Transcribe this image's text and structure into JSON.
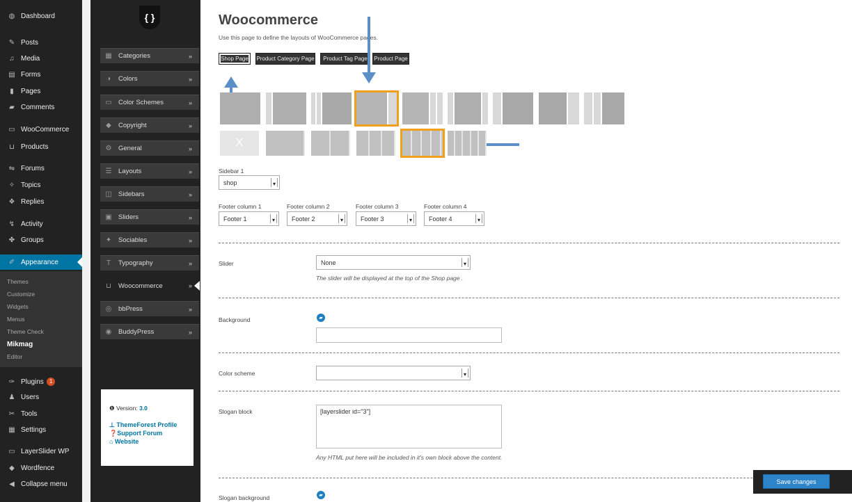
{
  "wp_menu": {
    "items": [
      {
        "label": "Dashboard",
        "icon": "dashboard-icon",
        "glyph": "◍"
      },
      {
        "label": "Posts",
        "icon": "pin-icon",
        "glyph": "✎"
      },
      {
        "label": "Media",
        "icon": "media-icon",
        "glyph": "♫"
      },
      {
        "label": "Forms",
        "icon": "forms-icon",
        "glyph": "▤"
      },
      {
        "label": "Pages",
        "icon": "pages-icon",
        "glyph": "▮"
      },
      {
        "label": "Comments",
        "icon": "comments-icon",
        "glyph": "▰"
      },
      {
        "label": "WooCommerce",
        "icon": "woocommerce-icon",
        "glyph": "▭"
      },
      {
        "label": "Products",
        "icon": "cart-icon",
        "glyph": "⊔"
      },
      {
        "label": "Forums",
        "icon": "forums-icon",
        "glyph": "⇋"
      },
      {
        "label": "Topics",
        "icon": "topics-icon",
        "glyph": "✧"
      },
      {
        "label": "Replies",
        "icon": "replies-icon",
        "glyph": "❖"
      },
      {
        "label": "Activity",
        "icon": "activity-icon",
        "glyph": "↯"
      },
      {
        "label": "Groups",
        "icon": "groups-icon",
        "glyph": "✤"
      },
      {
        "label": "Appearance",
        "icon": "paintbrush-icon",
        "glyph": "✐"
      },
      {
        "label": "Plugins",
        "icon": "plugin-icon",
        "glyph": "✑",
        "badge": "1"
      },
      {
        "label": "Users",
        "icon": "user-icon",
        "glyph": "♟"
      },
      {
        "label": "Tools",
        "icon": "wrench-icon",
        "glyph": "✂"
      },
      {
        "label": "Settings",
        "icon": "settings-icon",
        "glyph": "▦"
      },
      {
        "label": "LayerSlider WP",
        "icon": "layerslider-icon",
        "glyph": "▭"
      },
      {
        "label": "Wordfence",
        "icon": "wordfence-icon",
        "glyph": "◆"
      },
      {
        "label": "Collapse menu",
        "icon": "collapse-icon",
        "glyph": "◀"
      }
    ],
    "submenu": [
      "Themes",
      "Customize",
      "Widgets",
      "Menus",
      "Theme Check",
      "Mikmag",
      "Editor"
    ],
    "active_color": "#0074a2"
  },
  "theme_panel": {
    "logo": "{ }",
    "items": [
      {
        "label": "Categories",
        "icon": "categories-icon",
        "glyph": "▦"
      },
      {
        "label": "Colors",
        "icon": "colors-icon",
        "glyph": "◑"
      },
      {
        "label": "Color Schemes",
        "icon": "color-schemes-icon",
        "glyph": "▭"
      },
      {
        "label": "Copyright",
        "icon": "copyright-icon",
        "glyph": "◆"
      },
      {
        "label": "General",
        "icon": "gears-icon",
        "glyph": "⚙"
      },
      {
        "label": "Layouts",
        "icon": "layouts-icon",
        "glyph": "☰"
      },
      {
        "label": "Sidebars",
        "icon": "sidebars-icon",
        "glyph": "◫"
      },
      {
        "label": "Sliders",
        "icon": "sliders-icon",
        "glyph": "▣"
      },
      {
        "label": "Sociables",
        "icon": "twitter-icon",
        "glyph": "✦"
      },
      {
        "label": "Typography",
        "icon": "typography-icon",
        "glyph": "T"
      },
      {
        "label": "Woocommerce",
        "icon": "cart-icon",
        "glyph": "⊔"
      },
      {
        "label": "bbPress",
        "icon": "bbpress-icon",
        "glyph": "◎"
      },
      {
        "label": "BuddyPress",
        "icon": "buddypress-icon",
        "glyph": "◉"
      }
    ],
    "chevron": "»",
    "version_label": "Version:",
    "version": "3.0",
    "links": [
      "ThemeForest Profile",
      "Support Forum",
      "Website"
    ]
  },
  "main": {
    "title": "Woocommerce",
    "description": "Use this page to define the layouts of WooCommerce pages.",
    "tabs": [
      "Shop Page",
      "Product Category Page",
      "Product Tag Page",
      "Product Page"
    ],
    "active_tab": "Shop Page",
    "none_symbol": "X",
    "sidebar_label": "Sidebar 1",
    "sidebar_value": "shop",
    "footer_columns": [
      {
        "label": "Footer column 1",
        "value": "Footer 1"
      },
      {
        "label": "Footer column 2",
        "value": "Footer 2"
      },
      {
        "label": "Footer column 3",
        "value": "Footer 3"
      },
      {
        "label": "Footer column 4",
        "value": "Footer 4"
      }
    ],
    "slider_label": "Slider",
    "slider_value": "None",
    "slider_help": "The slider will be displayed at the top of the Shop page .",
    "background_label": "Background",
    "color_scheme_label": "Color scheme",
    "slogan_label": "Slogan block",
    "slogan_value": "[layerslider id=\"3\"]",
    "slogan_help": "Any HTML put here will be included in it's own block above the content.",
    "slogan_bg_label": "Slogan background",
    "save_label": "Save changes",
    "highlight_color": "#f0a01b",
    "arrow_color": "#5b8fc7"
  }
}
